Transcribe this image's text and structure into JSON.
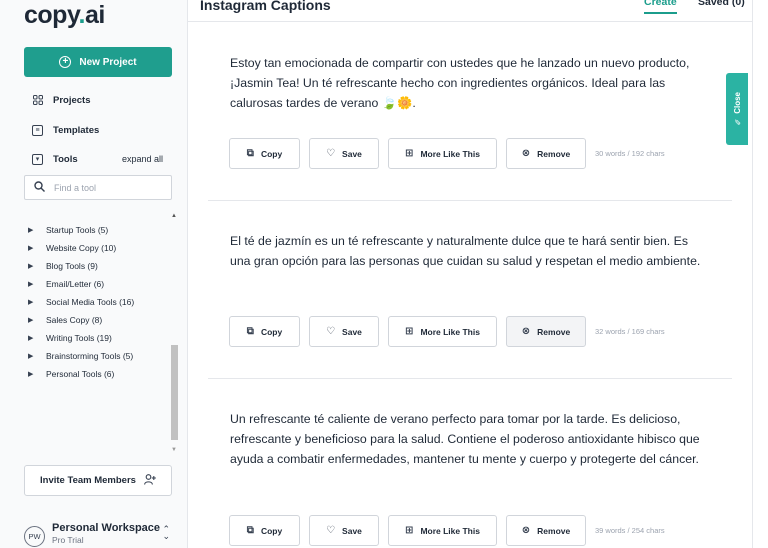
{
  "sidebar": {
    "logo_main": "copy",
    "logo_dot": ".",
    "logo_ai": "ai",
    "new_project": "New Project",
    "projects": "Projects",
    "templates": "Templates",
    "tools": "Tools",
    "expand_all": "expand all",
    "find_placeholder": "Find a tool",
    "tool_groups": [
      "Startup Tools (5)",
      "Website Copy (10)",
      "Blog Tools (9)",
      "Email/Letter (6)",
      "Social Media Tools (16)",
      "Sales Copy (8)",
      "Writing Tools (19)",
      "Brainstorming Tools (5)",
      "Personal Tools (6)"
    ],
    "invite": "Invite Team Members",
    "workspace_initials": "PW",
    "workspace_name": "Personal Workspace",
    "workspace_plan": "Pro Trial"
  },
  "header": {
    "title": "Instagram Captions",
    "tab_create": "Create",
    "tab_saved": "Saved (0)"
  },
  "actions": {
    "copy": "Copy",
    "save": "Save",
    "more": "More Like This",
    "remove": "Remove"
  },
  "results": [
    {
      "text": "Estoy tan emocionada de compartir con ustedes que he lanzado un nuevo producto, ¡Jasmin Tea! Un té refrescante hecho con ingredientes orgánicos. Ideal para las calurosas tardes de verano 🍃🌼.",
      "count": "30 words / 192 chars"
    },
    {
      "text": "El té de jazmín es un té refrescante y naturalmente dulce que te hará sentir bien. Es una gran opción para las personas que cuidan su salud y respetan el medio ambiente.",
      "count": "32 words / 169 chars"
    },
    {
      "text": "Un refrescante té caliente de verano perfecto para tomar por la tarde. Es delicioso, refrescante y beneficioso para la salud. Contiene el poderoso antioxidante hibisco que ayuda a combatir enfermedades, mantener tu mente y cuerpo y protegerte del cáncer.",
      "count": "39 words / 254 chars"
    }
  ],
  "close_tab": "Close",
  "colors": {
    "accent": "#1f9e8e",
    "close_tab": "#2bb3a3"
  }
}
